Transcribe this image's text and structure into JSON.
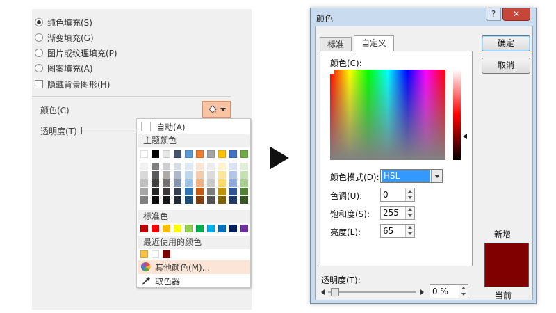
{
  "fill_panel": {
    "radio_options": [
      {
        "label": "纯色填充(S)",
        "checked": true
      },
      {
        "label": "渐变填充(G)",
        "checked": false
      },
      {
        "label": "图片或纹理填充(P)",
        "checked": false
      },
      {
        "label": "图案填充(A)",
        "checked": false
      }
    ],
    "hide_background_label": "隐藏背景图形(H)",
    "color_label": "颜色(C)",
    "transparency_label": "透明度(T)"
  },
  "color_menu": {
    "automatic_label": "自动(A)",
    "theme_colors_label": "主题颜色",
    "standard_colors_label": "标准色",
    "recent_colors_label": "最近使用的颜色",
    "more_colors_label": "其他颜色(M)...",
    "eyedropper_label": "取色器",
    "theme_colors": [
      "#ffffff",
      "#000000",
      "#e7e6e6",
      "#44546a",
      "#5b9bd5",
      "#ed7d31",
      "#a5a5a5",
      "#ffc000",
      "#4472c4",
      "#70ad47"
    ],
    "theme_shades": [
      [
        "#f2f2f2",
        "#d9d9d9",
        "#bfbfbf",
        "#a6a6a6",
        "#808080"
      ],
      [
        "#7f7f7f",
        "#595959",
        "#404040",
        "#262626",
        "#0d0d0d"
      ],
      [
        "#d0cece",
        "#aeabab",
        "#757171",
        "#3a3838",
        "#171616"
      ],
      [
        "#d6dce4",
        "#adb9ca",
        "#8497b0",
        "#333f4f",
        "#222a35"
      ],
      [
        "#deebf6",
        "#bdd7ee",
        "#9dc3e6",
        "#2e75b5",
        "#1f4e79"
      ],
      [
        "#fbe5d5",
        "#f7caac",
        "#f4b183",
        "#c55a11",
        "#833c0b"
      ],
      [
        "#ededed",
        "#dbdbdb",
        "#c9c9c9",
        "#7b7b7b",
        "#525252"
      ],
      [
        "#fff2cc",
        "#ffe598",
        "#ffd966",
        "#bf9000",
        "#7f6000"
      ],
      [
        "#d9e2f3",
        "#b4c6e7",
        "#8eaadb",
        "#2f5496",
        "#1f3864"
      ],
      [
        "#e2efd9",
        "#c5e0b3",
        "#a8d08d",
        "#538135",
        "#375623"
      ]
    ],
    "standard_colors": [
      "#c00000",
      "#ff0000",
      "#ffc000",
      "#ffff00",
      "#92d050",
      "#00b050",
      "#00b0f0",
      "#0070c0",
      "#002060",
      "#7030a0"
    ],
    "recent_colors": [
      "#f5c242",
      "#ffffff",
      "#800000"
    ]
  },
  "color_dialog": {
    "title": "颜色",
    "help_glyph": "?",
    "close_glyph": "✕",
    "tab_standard": "标准",
    "tab_custom": "自定义",
    "colors_label": "颜色(C):",
    "color_model_label": "颜色模式(D):",
    "color_model_value": "HSL",
    "hue_label": "色调(U):",
    "hue_value": "0",
    "saturation_label": "饱和度(S):",
    "saturation_value": "255",
    "luminance_label": "亮度(L):",
    "luminance_value": "65",
    "ok_label": "确定",
    "cancel_label": "取消",
    "new_label": "新增",
    "current_label": "当前",
    "transparency_label": "透明度(T):",
    "transparency_value": "0 %",
    "new_color": "#800000"
  }
}
